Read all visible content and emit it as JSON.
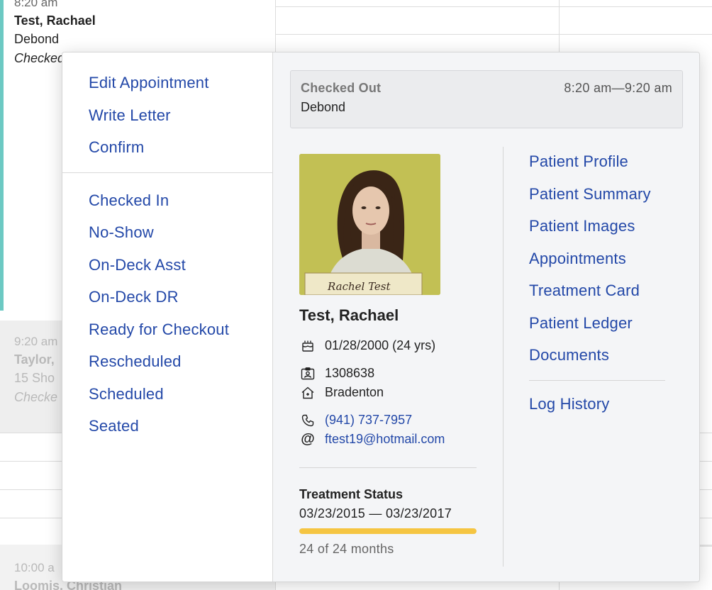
{
  "calendar": {
    "appointments": [
      {
        "time": "8:20 am",
        "name": "Test, Rachael",
        "type": "Debond",
        "status": "Checked Out"
      },
      {
        "time": "9:20 am",
        "name": "Taylor, ",
        "type": "15 Sho",
        "status": "Checke"
      },
      {
        "time": "10:00 a",
        "name": "Loomis, Christian"
      }
    ]
  },
  "menu": {
    "actions": [
      "Edit Appointment",
      "Write Letter",
      "Confirm"
    ],
    "statuses": [
      "Checked In",
      "No-Show",
      "On-Deck Asst",
      "On-Deck DR",
      "Ready for Checkout",
      "Rescheduled",
      "Scheduled",
      "Seated"
    ]
  },
  "appointment": {
    "status": "Checked Out",
    "time_range": "8:20 am—9:20 am",
    "type": "Debond"
  },
  "patient": {
    "name": "Test, Rachael",
    "photo_sign_text": "Rachel Test",
    "dob": "01/28/2000 (24 yrs)",
    "id": "1308638",
    "location": "Bradenton",
    "phone": "(941) 737-7957",
    "email": "ftest19@hotmail.com"
  },
  "treatment": {
    "label": "Treatment Status",
    "range": "03/23/2015 — 03/23/2017",
    "progress": 1.0,
    "months_text": "24 of 24 months"
  },
  "patient_links": [
    "Patient Profile",
    "Patient Summary",
    "Patient Images",
    "Appointments",
    "Treatment Card",
    "Patient Ledger",
    "Documents"
  ],
  "log_history_label": "Log History",
  "colors": {
    "link": "#2348a8",
    "progress": "#f5c542",
    "accent_bar": "#6cc9c3"
  }
}
